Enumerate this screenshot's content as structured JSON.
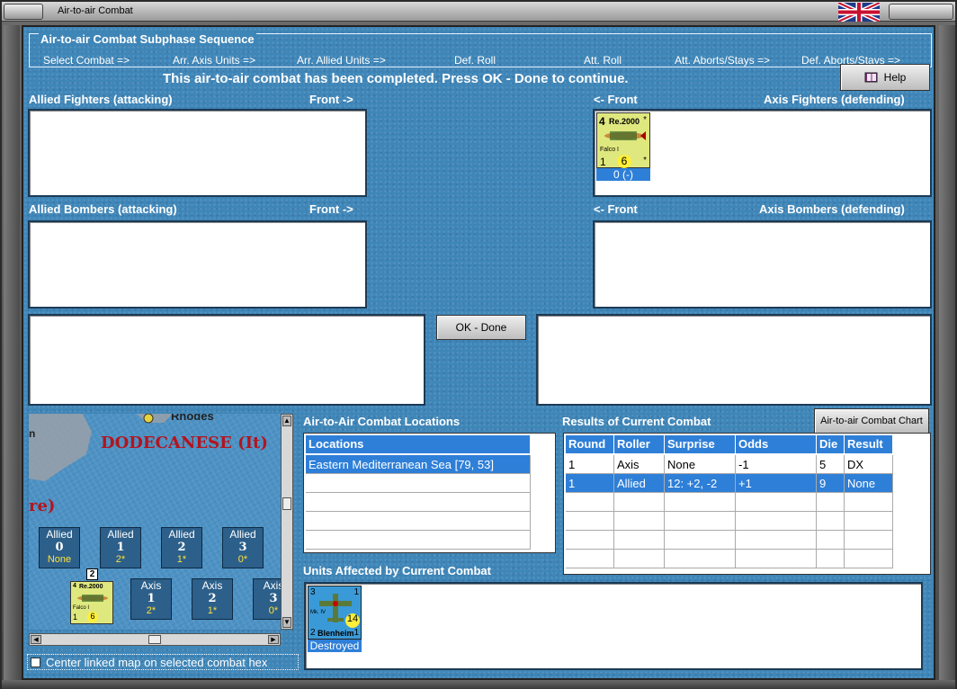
{
  "window": {
    "title": "Air-to-air Combat"
  },
  "sequence": {
    "title": "Air-to-air Combat Subphase Sequence",
    "steps": [
      "Select Combat =>",
      "Arr. Axis Units =>",
      "Arr. Allied Units =>",
      "Def. Roll",
      "Att. Roll",
      "Att. Aborts/Stays =>",
      "Def. Aborts/Stays =>"
    ]
  },
  "status_message": "This air-to-air combat has been completed.  Press OK - Done to continue.",
  "help_label": "Help",
  "ok_done_label": "OK - Done",
  "panels": {
    "allied_fighters": {
      "label": "Allied Fighters (attacking)",
      "front": "Front ->"
    },
    "axis_fighters": {
      "label": "Axis Fighters (defending)",
      "front": "<- Front"
    },
    "allied_bombers": {
      "label": "Allied Bombers (attacking)",
      "front": "Front ->"
    },
    "axis_bombers": {
      "label": "Axis Bombers (defending)",
      "front": "<- Front"
    }
  },
  "axis_fighter_unit": {
    "top_left": "4",
    "name": "Re.2000",
    "star": "*",
    "model": "Falco I",
    "bottom_left": "1",
    "bottom_mid": "6",
    "caption": "0 (-)"
  },
  "map": {
    "region": "DODECANESE (It)",
    "place": "Rhodes",
    "partial_label": "re)",
    "partial_n": "n",
    "stack_badge": "2",
    "allied_boxes": [
      {
        "title": "Allied",
        "num": "0",
        "sub": "None"
      },
      {
        "title": "Allied",
        "num": "1",
        "sub": "2*"
      },
      {
        "title": "Allied",
        "num": "2",
        "sub": "1*"
      },
      {
        "title": "Allied",
        "num": "3",
        "sub": "0*"
      }
    ],
    "axis_boxes": [
      {
        "title": "Axis",
        "num": "1",
        "sub": "2*"
      },
      {
        "title": "Axis",
        "num": "2",
        "sub": "1*"
      },
      {
        "title": "Axis",
        "num": "3",
        "sub": "0*"
      }
    ],
    "center_checkbox_label": "Center linked map on selected combat hex",
    "center_checkbox_checked": false
  },
  "locations": {
    "label": "Air-to-Air Combat Locations",
    "header": "Locations",
    "rows": [
      "Eastern Mediterranean Sea [79, 53]",
      "",
      "",
      "",
      ""
    ]
  },
  "results": {
    "label": "Results of Current Combat",
    "chart_button": "Air-to-air Combat Chart",
    "headers": [
      "Round",
      "Roller",
      "Surprise",
      "Odds",
      "Die",
      "Result"
    ],
    "rows": [
      [
        "1",
        "Axis",
        "None",
        "-1",
        "5",
        "DX"
      ],
      [
        "1",
        "Allied",
        "12: +2, -2",
        "+1",
        "9",
        "None"
      ],
      [
        "",
        "",
        "",
        "",
        "",
        ""
      ],
      [
        "",
        "",
        "",
        "",
        "",
        ""
      ],
      [
        "",
        "",
        "",
        "",
        "",
        ""
      ]
    ]
  },
  "affected": {
    "label": "Units Affected by Current Combat",
    "unit": {
      "top_left": "3",
      "top_right": "1",
      "model": "Mk. IV",
      "factor": "14",
      "bottom_left": "2",
      "name": "Blenheim",
      "bottom_right": "1",
      "caption": "Destroyed"
    }
  }
}
